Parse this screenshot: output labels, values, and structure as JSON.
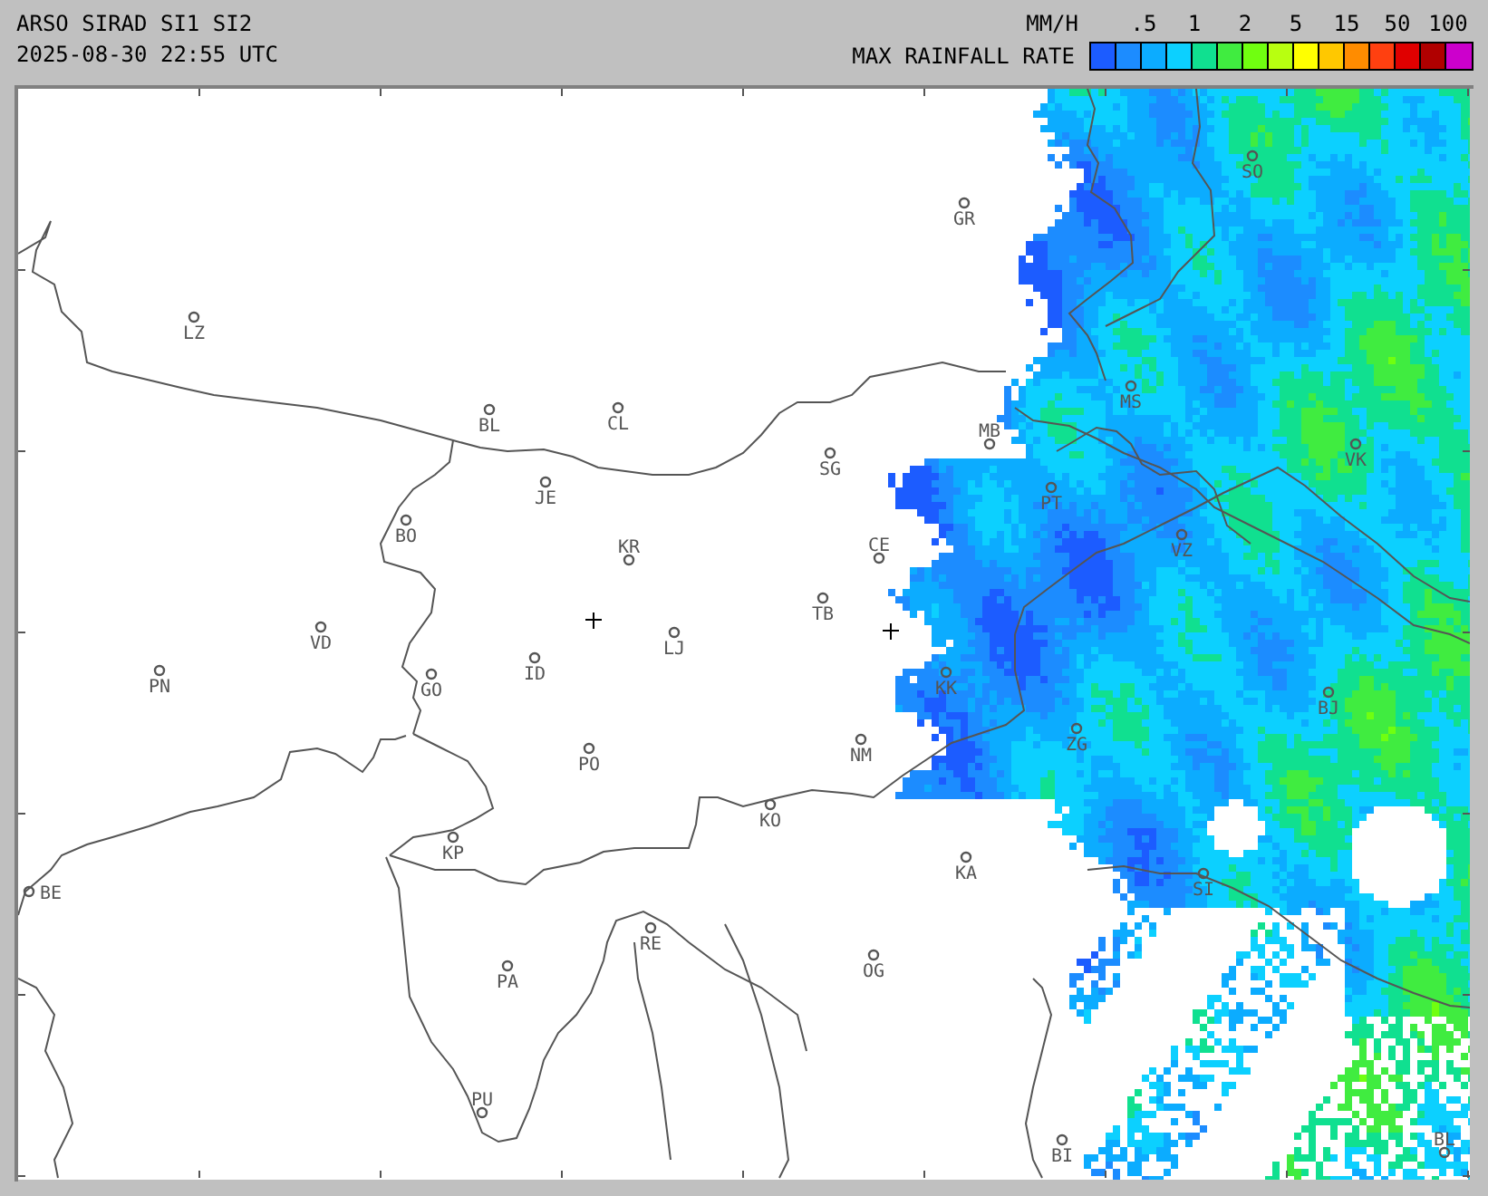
{
  "header": {
    "title": "ARSO SIRAD SI1 SI2",
    "timestamp": "2025-08-30 22:55 UTC"
  },
  "legend": {
    "unit": "MM/H",
    "caption": "MAX RAINFALL RATE",
    "ticks": [
      ".5",
      "1",
      "2",
      "5",
      "15",
      "50",
      "100"
    ],
    "scale": [
      {
        "color": "#1c5cff"
      },
      {
        "color": "#1c8cff"
      },
      {
        "color": "#0cacff"
      },
      {
        "color": "#0cd0ff"
      },
      {
        "color": "#10e090"
      },
      {
        "color": "#40ec40"
      },
      {
        "color": "#70ff10"
      },
      {
        "color": "#b8ff10"
      },
      {
        "color": "#ffff00"
      },
      {
        "color": "#ffc800"
      },
      {
        "color": "#ff8c00"
      },
      {
        "color": "#ff4010"
      },
      {
        "color": "#e00000"
      },
      {
        "color": "#b00000"
      },
      {
        "color": "#cc00cc"
      }
    ]
  },
  "map": {
    "towns": [
      {
        "label": "SO"
      },
      {
        "label": "GR"
      },
      {
        "label": "LZ"
      },
      {
        "label": "MS"
      },
      {
        "label": "BL"
      },
      {
        "label": "CL"
      },
      {
        "label": "MB"
      },
      {
        "label": "SG"
      },
      {
        "label": "VK"
      },
      {
        "label": "JE"
      },
      {
        "label": "PT"
      },
      {
        "label": "BO"
      },
      {
        "label": "KR"
      },
      {
        "label": "CE"
      },
      {
        "label": "VZ"
      },
      {
        "label": "TB"
      },
      {
        "label": "VD"
      },
      {
        "label": "LJ"
      },
      {
        "label": "PN"
      },
      {
        "label": "GO"
      },
      {
        "label": "ID"
      },
      {
        "label": "KK"
      },
      {
        "label": "BJ"
      },
      {
        "label": "PO"
      },
      {
        "label": "NM"
      },
      {
        "label": "ZG"
      },
      {
        "label": "KO"
      },
      {
        "label": "KP"
      },
      {
        "label": "KA"
      },
      {
        "label": "BE"
      },
      {
        "label": "SI"
      },
      {
        "label": "RE"
      },
      {
        "label": "PA"
      },
      {
        "label": "OG"
      },
      {
        "label": "PU"
      },
      {
        "label": "BI"
      },
      {
        "label": "BL"
      }
    ]
  }
}
